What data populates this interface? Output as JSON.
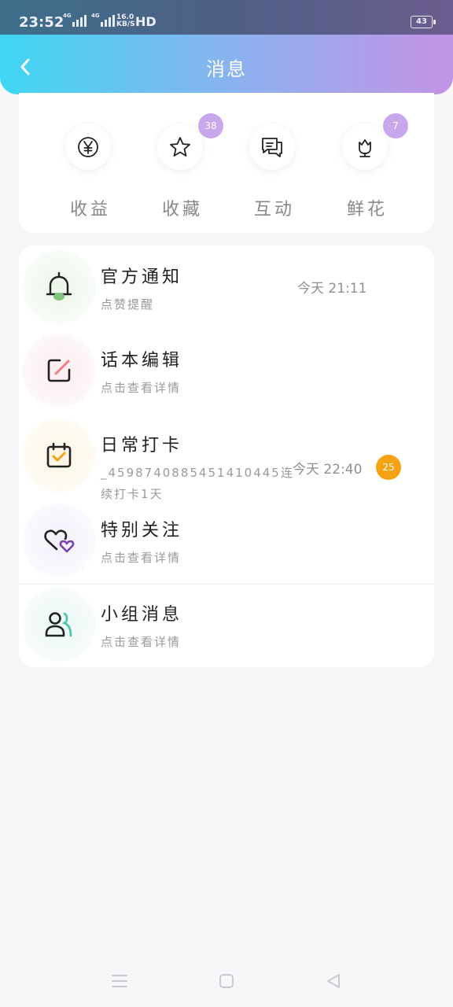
{
  "status": {
    "time": "23:52",
    "net1": "4G",
    "net2": "4G",
    "speed_value": "16.0",
    "speed_unit": "KB/S",
    "hd": "HD",
    "battery": "43"
  },
  "header": {
    "title": "消息"
  },
  "quick": [
    {
      "label": "收益",
      "icon": "yen-icon",
      "badge": ""
    },
    {
      "label": "收藏",
      "icon": "star-icon",
      "badge": "38"
    },
    {
      "label": "互动",
      "icon": "chat-icon",
      "badge": ""
    },
    {
      "label": "鲜花",
      "icon": "flower-icon",
      "badge": "7"
    }
  ],
  "messages": [
    {
      "name": "官方通知",
      "sub": "点赞提醒",
      "time": "今天 21:11",
      "count": "",
      "icon": "bell-icon"
    },
    {
      "name": "话本编辑",
      "sub": "点击查看详情",
      "time": "",
      "count": "",
      "icon": "edit-icon"
    },
    {
      "name": "日常打卡",
      "sub": "_4598740885451410445连续打卡1天",
      "time": "今天 22:40",
      "count": "25",
      "icon": "calendar-check-icon"
    },
    {
      "name": "特别关注",
      "sub": "点击查看详情",
      "time": "",
      "count": "",
      "icon": "hearts-icon"
    },
    {
      "name": "小组消息",
      "sub": "点击查看详情",
      "time": "",
      "count": "",
      "icon": "group-icon"
    }
  ],
  "colors": {
    "accent_start": "#3fd6f3",
    "accent_end": "#c293e6",
    "badge_purple": "#c8a8ec",
    "badge_orange": "#f5a214"
  }
}
